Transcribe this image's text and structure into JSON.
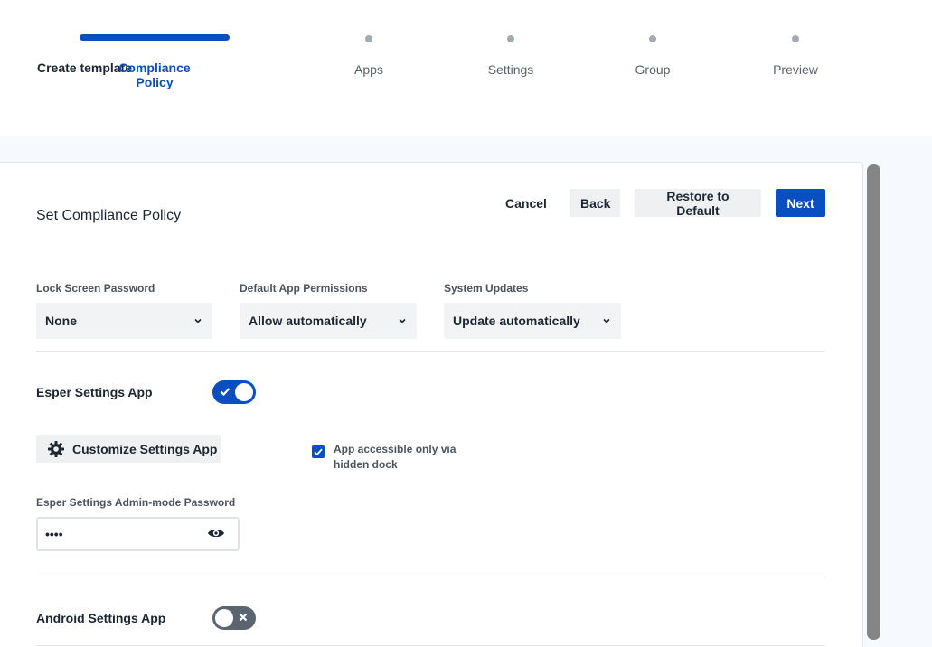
{
  "stepper": {
    "steps": [
      {
        "label": "Create template",
        "state": "done"
      },
      {
        "label": "Compliance Policy",
        "state": "active"
      },
      {
        "label": "Apps",
        "state": "todo"
      },
      {
        "label": "Settings",
        "state": "todo"
      },
      {
        "label": "Group",
        "state": "todo"
      },
      {
        "label": "Preview",
        "state": "todo"
      }
    ]
  },
  "header": {
    "title": "Set Compliance Policy",
    "cancel_label": "Cancel",
    "back_label": "Back",
    "restore_label": "Restore to Default",
    "next_label": "Next"
  },
  "policy": {
    "lock_screen": {
      "label": "Lock Screen Password",
      "value": "None"
    },
    "app_permissions": {
      "label": "Default App Permissions",
      "value": "Allow automatically"
    },
    "system_updates": {
      "label": "System Updates",
      "value": "Update automatically"
    }
  },
  "esper_settings": {
    "label": "Esper Settings App",
    "enabled": true,
    "customize_label": "Customize Settings App",
    "hidden_dock_label": "App accessible only via hidden dock",
    "hidden_dock_checked": true,
    "password_label": "Esper Settings Admin-mode Password",
    "password_value": "••••"
  },
  "android_settings": {
    "label": "Android Settings App",
    "enabled": false
  },
  "colors": {
    "accent": "#0a4fc2",
    "toggle_off": "#5a6570"
  },
  "icons": [
    "chevron-down-icon",
    "gear-icon",
    "checkmark-icon",
    "eye-icon",
    "close-icon"
  ]
}
